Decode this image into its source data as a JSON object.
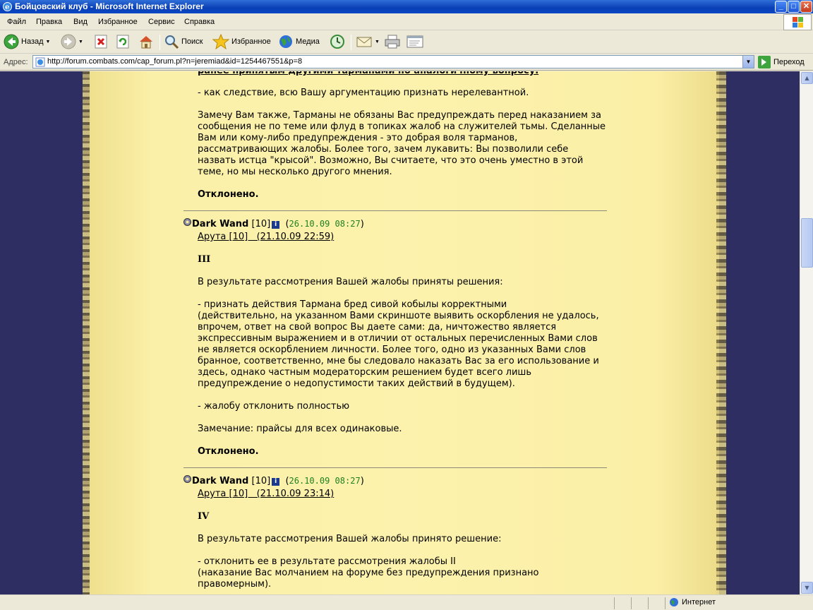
{
  "window": {
    "title": "Бойцовский клуб - Microsoft Internet Explorer",
    "minimize": "_",
    "maximize": "□",
    "close": "✕"
  },
  "menu": [
    "Файл",
    "Правка",
    "Вид",
    "Избранное",
    "Сервис",
    "Справка"
  ],
  "toolbar": {
    "back": "Назад",
    "search": "Поиск",
    "favorites": "Избранное",
    "media": "Медиа"
  },
  "address": {
    "label": "Адрес:",
    "url": "http://forum.combats.com/cap_forum.pl?n=jeremiad&id=1254467551&p=8",
    "go": "Переход"
  },
  "status": {
    "zone": "Интернет"
  },
  "posts": {
    "top": {
      "cut_line": "ранее принятым другими тарманами по аналогичному вопросу.",
      "line1": "- как следствие, всю Вашу аргументацию признать нерелевантной.",
      "p1": "Замечу Вам также, Тарманы не обязаны Вас предупреждать перед наказанием за",
      "p2": "сообщения не по теме или флуд в топиках жалоб на служителей тьмы. Сделанные",
      "p3": "Вам или кому-либо предупреждения - это добрая воля тарманов,",
      "p4": "рассматривающих жалобы. Более того, зачем лукавить: Вы позволили себе",
      "p5": "назвать истца \"крысой\". Возможно, Вы считаете, что это очень уместно в этой",
      "p6": "теме, но мы несколько другого мнения.",
      "verdict": "Отклонено."
    },
    "second": {
      "author": "Dark Wand",
      "level": "[10]",
      "info": "i",
      "open_paren": "(",
      "datetime": "26.10.09 08:27",
      "close_paren": ")",
      "link": "Арута [10]   (21.10.09 22:59)",
      "heading": "III",
      "intro": "В результате рассмотрения Вашей жалобы приняты решения:",
      "l1": "- признать действия Тармана бред сивой кобылы корректными",
      "l2": "(действительно, на указанном Вами скриншоте выявить оскорбления не удалось,",
      "l3": "впрочем, ответ на свой вопрос Вы даете сами: да, ничтожество является",
      "l4": "экспрессивным выражением и в отличии от остальных перечисленных Вами слов",
      "l5": "не является оскорблением личности. Более того, одно из указанных Вами слов",
      "l6": "бранное, соответственно, мне бы следовало наказать Вас за его использование и",
      "l7": "здесь, однако частным модераторским решением будет всего лишь",
      "l8": "предупреждение о недопустимости таких действий в будущем).",
      "l9": "- жалобу отклонить полностью",
      "note": "Замечание: прайсы для всех одинаковые.",
      "verdict": "Отклонено."
    },
    "third": {
      "author": "Dark Wand",
      "level": "[10]",
      "info": "i",
      "open_paren": "(",
      "datetime": "26.10.09 08:27",
      "close_paren": ")",
      "link": "Арута [10]   (21.10.09 23:14)",
      "heading": "IV",
      "intro": "В результате рассмотрения Вашей жалобы принято решение:",
      "l1": "- отклонить ее в результате рассмотрения жалобы II",
      "l2": "(наказание Вас молчанием на форуме без предупреждения признано",
      "l3": "правомерным)."
    }
  }
}
